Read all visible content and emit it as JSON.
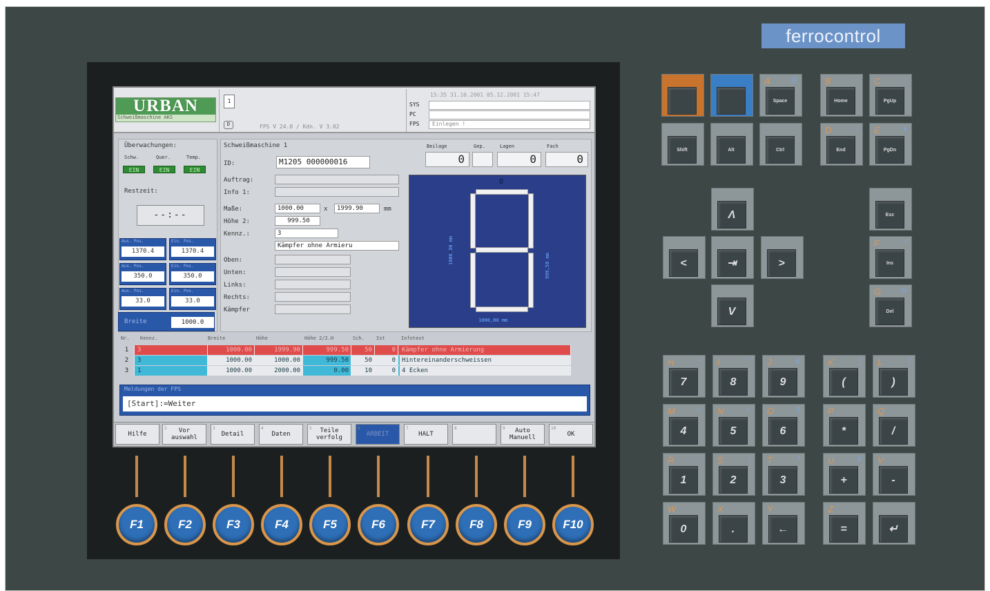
{
  "brand": "ferrocontrol",
  "header": {
    "logo": "URBAN",
    "logo_sub": "Schweißmaschine AKS",
    "doc_icon": "1",
    "d_icon": "D",
    "fps": "FPS  V 24.0 / Kdn. V 3.02",
    "datetime": "15:35 31.10.2001  05.12.2001  15:47",
    "sys_labels": [
      "SYS",
      "PC",
      "FPS"
    ],
    "sys_values": [
      "",
      "",
      "Einlegen !"
    ]
  },
  "left": {
    "ueberw": "Überwachungen:",
    "cols": [
      "Schw.",
      "Quer.",
      "Temp."
    ],
    "states": [
      "EIN",
      "EIN",
      "EIN"
    ],
    "restzeit_label": "Restzeit:",
    "restzeit": "--:--",
    "pairs": [
      {
        "l1": "Aus. Pos.",
        "v1": "1370.4",
        "l2": "Ein. Pos.",
        "v2": "1370.4"
      },
      {
        "l1": "Aus. Pos.",
        "v1": "350.0",
        "l2": "Ein. Pos.",
        "v2": "350.0"
      },
      {
        "l1": "Aus. Pos.",
        "v1": "33.0",
        "l2": "Ein. Pos.",
        "v2": "33.0"
      }
    ],
    "breite_label": "Breite",
    "breite": "1000.0"
  },
  "main": {
    "title": "Schweißmaschine 1",
    "id_label": "ID:",
    "id": "M1205 000000016",
    "count_labels": [
      "Beilage",
      "Gep.",
      "Lagen",
      "Fach"
    ],
    "counts": [
      "0",
      "",
      "0",
      "0"
    ],
    "auftrag_label": "Auftrag:",
    "info_label": "Info 1:",
    "masse_label": "Maße:",
    "masse_a": "1000.00",
    "masse_x": "x",
    "masse_b": "1999.90",
    "masse_unit": "mm",
    "hoehe_label": "Höhe 2:",
    "hoehe": "999.50",
    "kennz_label": "Kennz.:",
    "kennz": "3",
    "kaempfer_text": "Kämpfer ohne Armieru",
    "side_labels": [
      "Oben:",
      "Unten:",
      "Links:",
      "Rechts:",
      "Kämpfer"
    ]
  },
  "diagram": {
    "top": "O",
    "left": "L",
    "vert": "1000,00 mm",
    "right": "999,50 mm",
    "bottom": "1000,00 mm"
  },
  "table": {
    "headers": [
      "Nr.",
      "Kennz.",
      "Breite",
      "Höhe",
      "Höhe 2/2.H",
      "Sch.",
      "Ist",
      "Infotext"
    ],
    "rows": [
      [
        "1",
        "3",
        "1000.00",
        "1999.90",
        "999.50",
        "50",
        "0",
        "Kämpfer ohne Armierung"
      ],
      [
        "2",
        "3",
        "1000.00",
        "1000.00",
        "999.50",
        "50",
        "0",
        "Hintereinanderschweissen"
      ],
      [
        "3",
        "1",
        "1000.00",
        "2000.00",
        "0.00",
        "10",
        "0",
        "4 Ecken"
      ]
    ]
  },
  "messages": {
    "label": "Meldungen der FPS",
    "text": "[Start]:=Weiter"
  },
  "fkeys": [
    "Hilfe",
    "Vor\nauswahl",
    "Detail",
    "Daten",
    "Teile\nverfolg",
    "ARBEIT",
    "HALT",
    "",
    "Auto\nManuell",
    "OK"
  ],
  "fbuttons": [
    "F1",
    "F2",
    "F3",
    "F4",
    "F5",
    "F6",
    "F7",
    "F8",
    "F9",
    "F10"
  ],
  "keys": [
    {
      "cap": "",
      "ltr": "",
      "sym": ""
    },
    {
      "cap": "",
      "ltr": "",
      "sym": ""
    },
    {
      "cap": "Space",
      "ltr": "A",
      "sym": "@"
    },
    {
      "cap": "Home",
      "ltr": "B",
      "sym": "~"
    },
    {
      "cap": "PgUp",
      "ltr": "C",
      "sym": "-"
    },
    {
      "cap": "Shift",
      "ltr": "",
      "sym": ""
    },
    {
      "cap": "Alt",
      "ltr": "",
      "sym": ""
    },
    {
      "cap": "Ctrl",
      "ltr": "",
      "sym": ""
    },
    {
      "cap": "End",
      "ltr": "D",
      "sym": "/"
    },
    {
      "cap": "PgDn",
      "ltr": "E",
      "sym": "#"
    },
    {
      "cap": "Λ",
      "ltr": "",
      "sym": ""
    },
    {
      "cap": "Esc",
      "ltr": "",
      "sym": ""
    },
    {
      "cap": "<",
      "ltr": "",
      "sym": ""
    },
    {
      "cap": "⇥",
      "ltr": "",
      "sym": ""
    },
    {
      "cap": ">",
      "ltr": "",
      "sym": ""
    },
    {
      "cap": "Ins",
      "ltr": "F",
      "sym": "^"
    },
    {
      "cap": "V",
      "ltr": "",
      "sym": ""
    },
    {
      "cap": "Del",
      "ltr": "G",
      "sym": "%"
    },
    {
      "cap": "7",
      "ltr": "H",
      "sym": "!"
    },
    {
      "cap": "8",
      "ltr": "I",
      "sym": "\""
    },
    {
      "cap": "9",
      "ltr": "J",
      "sym": "&"
    },
    {
      "cap": "(",
      "ltr": "K",
      "sym": "["
    },
    {
      "cap": ")",
      "ltr": "L",
      "sym": "]"
    },
    {
      "cap": "4",
      "ltr": "M",
      "sym": "<"
    },
    {
      "cap": "5",
      "ltr": "N",
      "sym": ">"
    },
    {
      "cap": "6",
      "ltr": "O",
      "sym": "$"
    },
    {
      "cap": "*",
      "ltr": "P",
      "sym": ""
    },
    {
      "cap": "/",
      "ltr": "Q",
      "sym": ""
    },
    {
      "cap": "1",
      "ltr": "R",
      "sym": "'"
    },
    {
      "cap": "2",
      "ltr": "S",
      "sym": "!"
    },
    {
      "cap": "3",
      "ltr": "T",
      "sym": "?"
    },
    {
      "cap": "+",
      "ltr": "U",
      "sym": "$"
    },
    {
      "cap": "-",
      "ltr": "V",
      "sym": ""
    },
    {
      "cap": "0",
      "ltr": "W",
      "sym": ""
    },
    {
      "cap": ".",
      "ltr": "X",
      "sym": ""
    },
    {
      "cap": "←",
      "ltr": "Y",
      "sym": ""
    },
    {
      "cap": "=",
      "ltr": "Z",
      "sym": ""
    },
    {
      "cap": "↵",
      "ltr": "",
      "sym": ""
    }
  ],
  "colors": {
    "panel": "#3d4745",
    "brand": "#6b93c8",
    "row1": "#e04b4b",
    "row2": "#40b8d8",
    "blue": "#2a58a8",
    "green": "#2f8a33"
  }
}
